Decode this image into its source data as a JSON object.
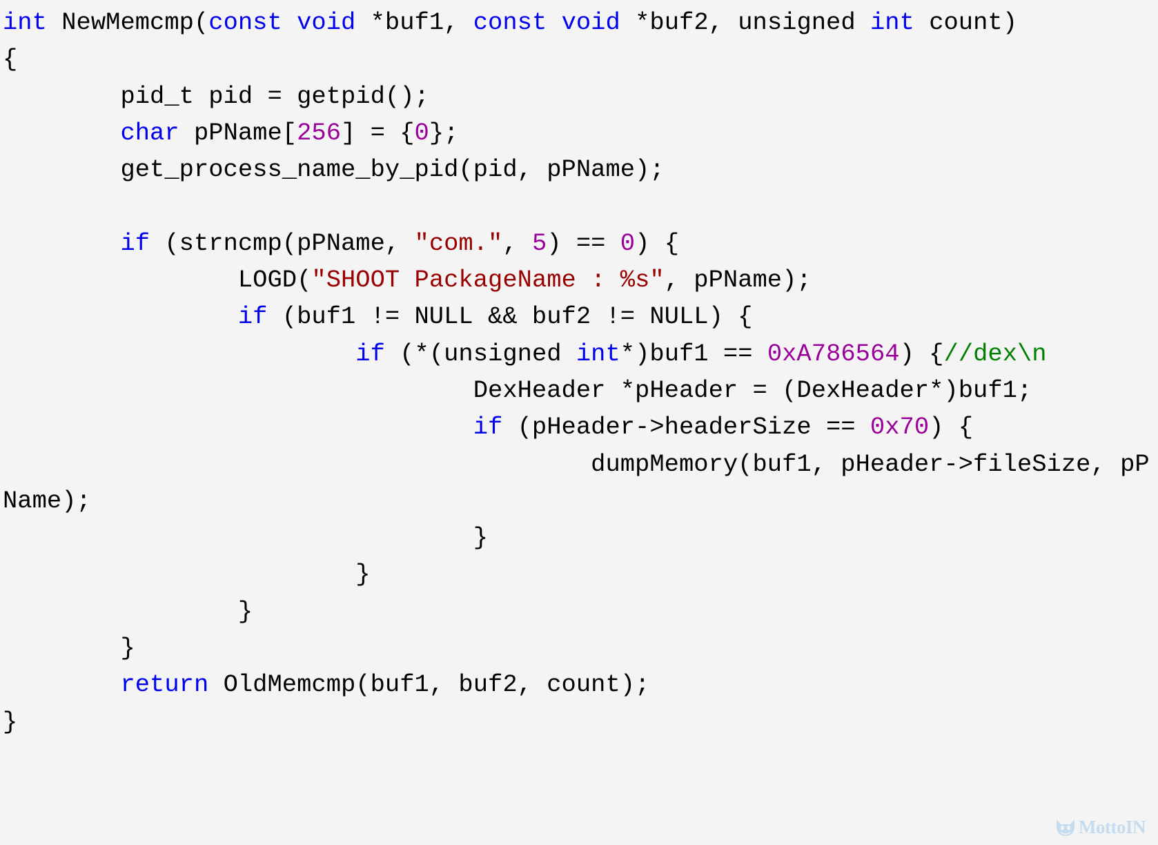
{
  "page": {
    "kind": "source-code-screenshot",
    "language": "C",
    "background_color": "#f4f4f4",
    "default_text_color": "#000000"
  },
  "syntax_colors": {
    "keyword": "#0000ee",
    "string": "#990000",
    "number": "#9a009a",
    "comment": "#008000",
    "plain": "#000000"
  },
  "code": {
    "lines": [
      {
        "id": "line-1",
        "tokens": [
          {
            "t": "int",
            "c": "kw"
          },
          {
            "t": " NewMemcmp(",
            "c": "txt"
          },
          {
            "t": "const void",
            "c": "kw"
          },
          {
            "t": " *buf1, ",
            "c": "txt"
          },
          {
            "t": "const void",
            "c": "kw"
          },
          {
            "t": " *buf2, unsigned ",
            "c": "txt"
          },
          {
            "t": "int",
            "c": "kw"
          },
          {
            "t": " count)",
            "c": "txt"
          }
        ]
      },
      {
        "id": "line-2",
        "tokens": [
          {
            "t": "{",
            "c": "txt"
          }
        ]
      },
      {
        "id": "line-3",
        "tokens": [
          {
            "t": "        pid_t pid = getpid();",
            "c": "txt"
          }
        ]
      },
      {
        "id": "line-4",
        "tokens": [
          {
            "t": "        ",
            "c": "txt"
          },
          {
            "t": "char",
            "c": "kw"
          },
          {
            "t": " pPName[",
            "c": "txt"
          },
          {
            "t": "256",
            "c": "num"
          },
          {
            "t": "] = {",
            "c": "txt"
          },
          {
            "t": "0",
            "c": "num"
          },
          {
            "t": "};",
            "c": "txt"
          }
        ]
      },
      {
        "id": "line-5",
        "tokens": [
          {
            "t": "        get_process_name_by_pid(pid, pPName);",
            "c": "txt"
          }
        ]
      },
      {
        "id": "line-6",
        "tokens": [
          {
            "t": "",
            "c": "txt"
          }
        ]
      },
      {
        "id": "line-7",
        "tokens": [
          {
            "t": "        ",
            "c": "txt"
          },
          {
            "t": "if",
            "c": "kw"
          },
          {
            "t": " (strncmp(pPName, ",
            "c": "txt"
          },
          {
            "t": "\"com.\"",
            "c": "str"
          },
          {
            "t": ", ",
            "c": "txt"
          },
          {
            "t": "5",
            "c": "num"
          },
          {
            "t": ") == ",
            "c": "txt"
          },
          {
            "t": "0",
            "c": "num"
          },
          {
            "t": ") {",
            "c": "txt"
          }
        ]
      },
      {
        "id": "line-8",
        "tokens": [
          {
            "t": "                LOGD(",
            "c": "txt"
          },
          {
            "t": "\"SHOOT PackageName : %s\"",
            "c": "str"
          },
          {
            "t": ", pPName);",
            "c": "txt"
          }
        ]
      },
      {
        "id": "line-9",
        "tokens": [
          {
            "t": "                ",
            "c": "txt"
          },
          {
            "t": "if",
            "c": "kw"
          },
          {
            "t": " (buf1 != NULL && buf2 != NULL) {",
            "c": "txt"
          }
        ]
      },
      {
        "id": "line-10",
        "tokens": [
          {
            "t": "                        ",
            "c": "txt"
          },
          {
            "t": "if",
            "c": "kw"
          },
          {
            "t": " (*(unsigned ",
            "c": "txt"
          },
          {
            "t": "int",
            "c": "kw"
          },
          {
            "t": "*)buf1 == ",
            "c": "txt"
          },
          {
            "t": "0xA786564",
            "c": "num"
          },
          {
            "t": ") {",
            "c": "txt"
          },
          {
            "t": "//dex\\n",
            "c": "cmt"
          }
        ]
      },
      {
        "id": "line-11",
        "tokens": [
          {
            "t": "                                DexHeader *pHeader = (DexHeader*)buf1;",
            "c": "txt"
          }
        ]
      },
      {
        "id": "line-12",
        "tokens": [
          {
            "t": "                                ",
            "c": "txt"
          },
          {
            "t": "if",
            "c": "kw"
          },
          {
            "t": " (pHeader->headerSize == ",
            "c": "txt"
          },
          {
            "t": "0x70",
            "c": "num"
          },
          {
            "t": ") {",
            "c": "txt"
          }
        ]
      },
      {
        "id": "line-13",
        "tokens": [
          {
            "t": "                                        dumpMemory(buf1, pHeader->fileSize, pPName);",
            "c": "txt"
          }
        ]
      },
      {
        "id": "line-14",
        "tokens": [
          {
            "t": "                                }",
            "c": "txt"
          }
        ]
      },
      {
        "id": "line-15",
        "tokens": [
          {
            "t": "                        }",
            "c": "txt"
          }
        ]
      },
      {
        "id": "line-16",
        "tokens": [
          {
            "t": "                }",
            "c": "txt"
          }
        ]
      },
      {
        "id": "line-17",
        "tokens": [
          {
            "t": "        }",
            "c": "txt"
          }
        ]
      },
      {
        "id": "line-18",
        "tokens": [
          {
            "t": "        ",
            "c": "txt"
          },
          {
            "t": "return",
            "c": "kw"
          },
          {
            "t": " OldMemcmp(buf1, buf2, count);",
            "c": "txt"
          }
        ]
      },
      {
        "id": "line-19",
        "tokens": [
          {
            "t": "}",
            "c": "txt"
          }
        ]
      }
    ]
  },
  "watermark": {
    "text": "MottoIN",
    "color": "#c3dcf0",
    "logo_icon": "cat-face-icon"
  }
}
